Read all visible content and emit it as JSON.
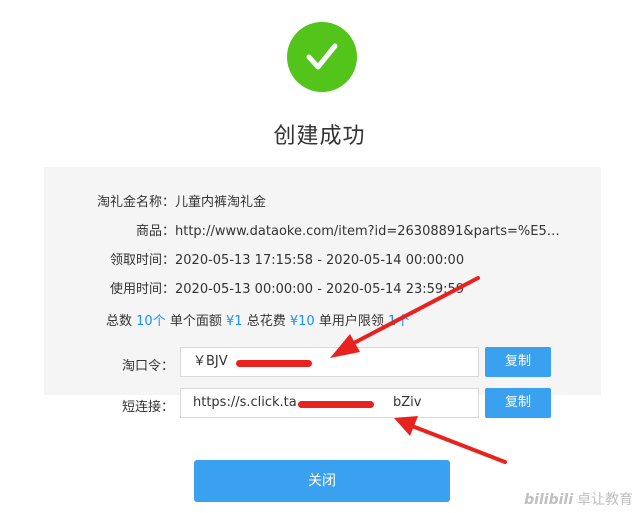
{
  "header": {
    "icon": "check-circle-icon",
    "icon_color": "#52c41a",
    "title": "创建成功"
  },
  "details": {
    "name": {
      "label": "淘礼金名称：",
      "value": "儿童内裤淘礼金"
    },
    "goods": {
      "label": "商品：",
      "value": "http://www.dataoke.com/item?id=26308891&parts=%E5%95..."
    },
    "claim_time": {
      "label": "领取时间：",
      "value": "2020-05-13 17:15:58 - 2020-05-14 00:00:00"
    },
    "use_time": {
      "label": "使用时间：",
      "value": "2020-05-13 00:00:00 - 2020-05-14 23:59:59"
    }
  },
  "summary": {
    "total_label": "总数",
    "total_value": "10个",
    "face_label": "单个面额",
    "face_value": "¥1",
    "cost_label": "总花费",
    "cost_value": "¥10",
    "limit_label": "单用户限领",
    "limit_value": "1个"
  },
  "fields": {
    "taokouling": {
      "label": "淘口令：",
      "value": "￥BJV",
      "copy_label": "复制"
    },
    "short_link": {
      "label": "短连接：",
      "value": "https://s.click.ta",
      "value_tail": "bZiv",
      "copy_label": "复制"
    }
  },
  "footer": {
    "close_label": "关闭"
  },
  "watermark": {
    "logo": "bilibili",
    "text": "卓让教育"
  },
  "colors": {
    "accent": "#3aa0f0",
    "success": "#52c41a",
    "highlight_number": "#1890ff",
    "annotation": "#e8231f"
  }
}
